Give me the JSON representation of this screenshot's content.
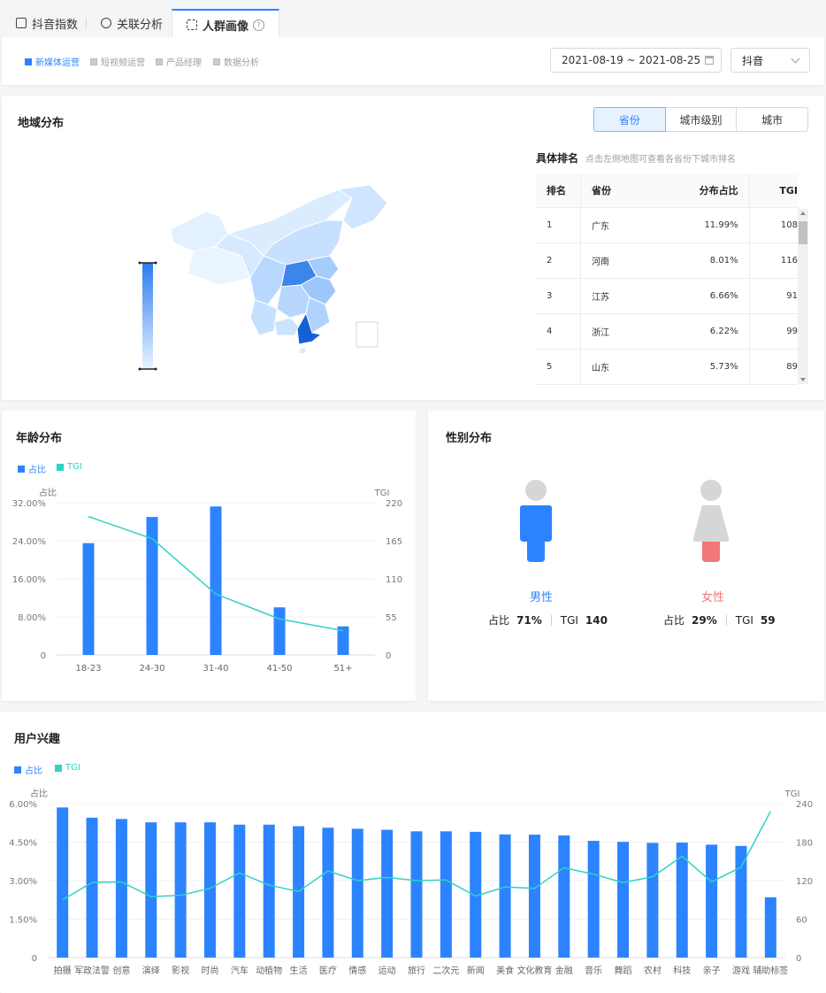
{
  "tabs": [
    {
      "label": "抖音指数"
    },
    {
      "label": "关联分析"
    },
    {
      "label": "人群画像"
    }
  ],
  "filters": {
    "tags": [
      {
        "label": "新媒体运营",
        "active": true
      },
      {
        "label": "短视频运营",
        "active": false
      },
      {
        "label": "产品经理",
        "active": false
      },
      {
        "label": "数据分析",
        "active": false
      }
    ],
    "date_range": "2021-08-19 ~ 2021-08-25",
    "platform": "抖音"
  },
  "region": {
    "title": "地域分布",
    "toggles": [
      "省份",
      "城市级别",
      "城市"
    ],
    "active_toggle": "省份",
    "rank_title": "具体排名",
    "rank_hint": "点击左侧地图可查看各省份下城市排名",
    "columns": [
      "排名",
      "省份",
      "分布占比",
      "TGI"
    ],
    "rows": [
      [
        "1",
        "广东",
        "11.99%",
        "108"
      ],
      [
        "2",
        "河南",
        "8.01%",
        "116"
      ],
      [
        "3",
        "江苏",
        "6.66%",
        "91"
      ],
      [
        "4",
        "浙江",
        "6.22%",
        "99"
      ],
      [
        "5",
        "山东",
        "5.73%",
        "89"
      ]
    ]
  },
  "age": {
    "title": "年龄分布",
    "legend": [
      "占比",
      "TGI"
    ],
    "left_unit": "占比",
    "right_unit": "TGI",
    "y_ticks": [
      "32.00%",
      "24.00%",
      "16.00%",
      "8.00%",
      "0"
    ],
    "y2_ticks": [
      "220",
      "165",
      "110",
      "55",
      "0"
    ]
  },
  "gender": {
    "title": "性别分布",
    "male": {
      "label": "男性",
      "ratio_label": "占比",
      "ratio": "71%",
      "tgi_label": "TGI",
      "tgi": "140"
    },
    "female": {
      "label": "女性",
      "ratio_label": "占比",
      "ratio": "29%",
      "tgi_label": "TGI",
      "tgi": "59"
    }
  },
  "interest": {
    "title": "用户兴趣",
    "legend": [
      "占比",
      "TGI"
    ],
    "left_unit": "占比",
    "right_unit": "TGI",
    "y_ticks": [
      "6.00%",
      "4.50%",
      "3.00%",
      "1.50%",
      "0"
    ],
    "y2_ticks": [
      "240",
      "180",
      "120",
      "60",
      "0"
    ]
  },
  "colors": {
    "accent": "#2c83ff",
    "tgi": "#2ed3c4",
    "female": "#f07878",
    "gray": "#d6d6d6"
  },
  "chart_data": [
    {
      "type": "bar",
      "title": "年龄分布",
      "categories": [
        "18-23",
        "24-30",
        "31-40",
        "41-50",
        "51+"
      ],
      "series": [
        {
          "name": "占比",
          "values": [
            23.5,
            29.0,
            31.2,
            10.0,
            6.0
          ]
        },
        {
          "name": "TGI",
          "type": "line",
          "axis": "right",
          "values": [
            200,
            168,
            88,
            52,
            35
          ]
        }
      ],
      "ylim": [
        0,
        32
      ],
      "y2lim": [
        0,
        220
      ],
      "legend": "top-left"
    },
    {
      "type": "bar",
      "title": "用户兴趣",
      "categories": [
        "拍摄",
        "军政法警",
        "创意",
        "演绎",
        "影视",
        "时尚",
        "汽车",
        "动植物",
        "生活",
        "医疗",
        "情感",
        "运动",
        "旅行",
        "二次元",
        "新闻",
        "美食",
        "文化教育",
        "金融",
        "音乐",
        "舞蹈",
        "农村",
        "科技",
        "亲子",
        "游戏",
        "辅助标签"
      ],
      "series": [
        {
          "name": "占比",
          "values": [
            5.85,
            5.45,
            5.4,
            5.27,
            5.27,
            5.27,
            5.18,
            5.18,
            5.12,
            5.06,
            5.02,
            4.98,
            4.92,
            4.92,
            4.9,
            4.8,
            4.79,
            4.76,
            4.55,
            4.51,
            4.47,
            4.48,
            4.4,
            4.35,
            2.35
          ]
        },
        {
          "name": "TGI",
          "type": "line",
          "axis": "right",
          "values": [
            90,
            117,
            118,
            95,
            97,
            108,
            132,
            113,
            103,
            135,
            120,
            125,
            120,
            121,
            96,
            110,
            108,
            140,
            130,
            117,
            126,
            158,
            118,
            141,
            228
          ]
        }
      ],
      "ylim": [
        0,
        6
      ],
      "y2lim": [
        0,
        240
      ],
      "legend": "top-left"
    }
  ]
}
